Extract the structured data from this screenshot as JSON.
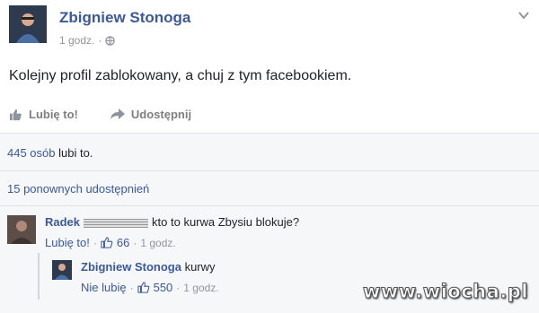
{
  "post": {
    "author": "Zbigniew Stonoga",
    "time": "1 godz.",
    "meta_sep": "·",
    "text": "Kolejny profil zablokowany, a chuj z tym facebookiem.",
    "actions": {
      "like": "Lubię to!",
      "share": "Udostępnij"
    }
  },
  "likes": {
    "link": "445 osób",
    "suffix": " lubi to."
  },
  "shares": {
    "text": "15 ponownych udostępnień"
  },
  "comments": [
    {
      "author": "Radek",
      "text": "kto to kurwa Zbysiu blokuje?",
      "like_label": "Lubię to!",
      "dot": "·",
      "likes": "66",
      "time": "1 godz."
    },
    {
      "author": "Zbigniew Stonoga",
      "text": "kurwy",
      "like_label": "Nie lubię",
      "dot": "·",
      "likes": "550",
      "time": "1 godz."
    }
  ],
  "watermark": "www.wiocha.pl",
  "colors": {
    "link": "#3b5998",
    "muted": "#90949c",
    "text": "#1d2129"
  }
}
